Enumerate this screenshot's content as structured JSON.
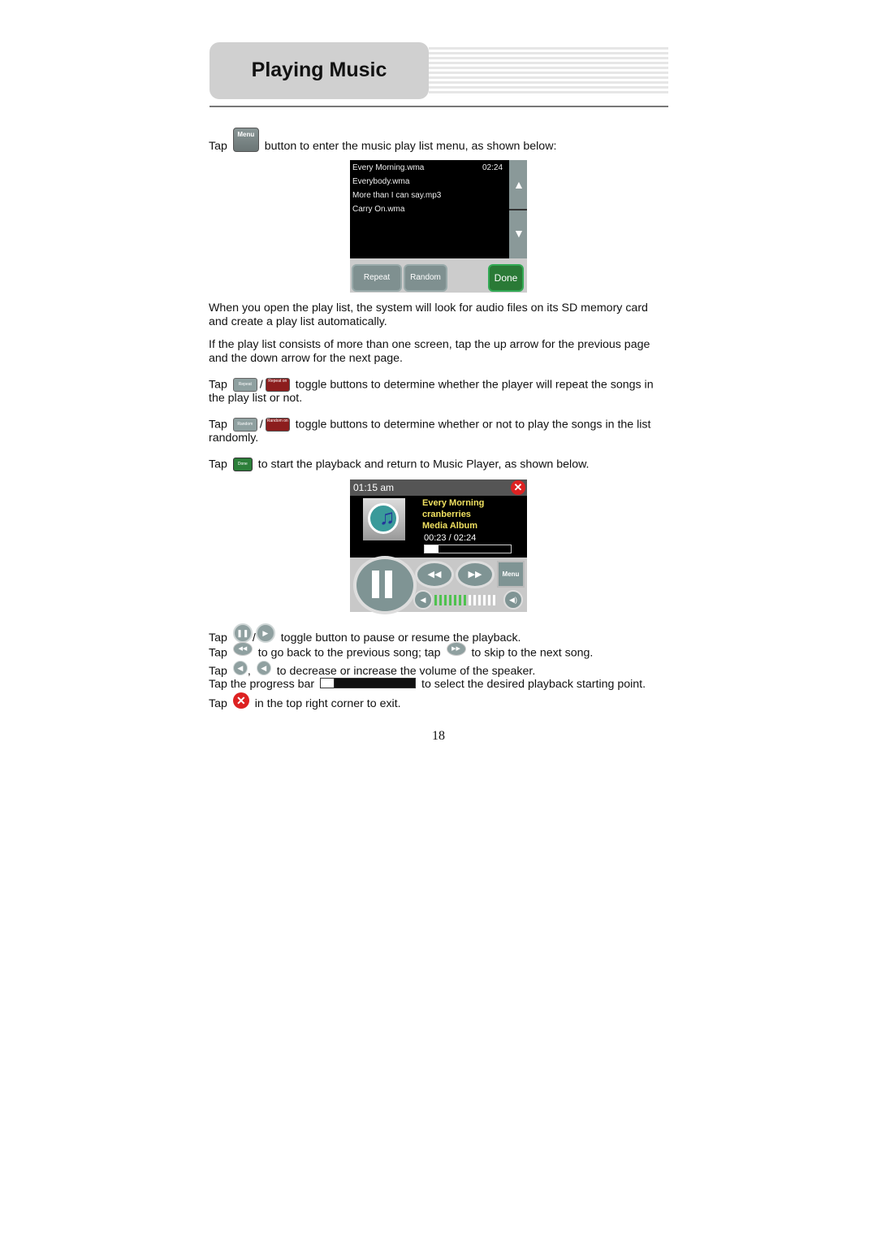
{
  "header": {
    "title": "Playing Music"
  },
  "intro": {
    "prefix": "Tap",
    "icon_label": "Menu",
    "suffix": "button to enter the music play list menu, as shown below:"
  },
  "playlist_screen": {
    "items": [
      "Every Morning.wma",
      "Everybody.wma",
      "More than I can say.mp3",
      "Carry On.wma"
    ],
    "current_duration": "02:24",
    "up_arrow": "▲",
    "down_arrow": "▼",
    "buttons": {
      "repeat": "Repeat",
      "random": "Random",
      "done": "Done"
    }
  },
  "paragraphs": {
    "p1": "When you open the play list, the system will look for audio files on its SD memory card and create a play list automatically.",
    "p2": "If the play list consists of more than one screen, tap the up arrow for the previous page and the down arrow for the next page."
  },
  "instructions": {
    "tap": "Tap",
    "slash": "/",
    "repeat_off_icon": "Repeat",
    "repeat_on_icon": "Repeat on",
    "repeat_text": "toggle buttons to determine whether the player will repeat the songs in",
    "repeat_text2": "the play list or not.",
    "random_off_icon": "Random",
    "random_on_icon": "Random on",
    "random_text": "toggle buttons to determine whether or not to play the songs in the list",
    "random_text2": "randomly.",
    "done_icon": "Done",
    "done_text": "to start the playback and return to Music Player, as shown below."
  },
  "player_screen": {
    "clock": "01:15  am",
    "title": "Every Morning",
    "artist": "cranberries",
    "album": "Media Album",
    "elapsed": "00:23",
    "separator": "/",
    "total": "02:24",
    "progress_fraction": 0.16,
    "volume_level": 7,
    "volume_max": 13,
    "menu_label": "Menu",
    "close_glyph": "✕",
    "rewind_glyph": "◀◀",
    "forward_glyph": "▶▶",
    "vol_down_glyph": "◀",
    "vol_up_glyph": "◀)",
    "accent_green": "#4fc24f",
    "title_color": "#f0e060"
  },
  "controls_help": {
    "pause_play_text": "toggle button to pause or resume the playback.",
    "prev_text": "to go back to the previous song; tap",
    "next_text": "to skip to the next song.",
    "comma": ",",
    "volume_text": "to decrease or increase the volume of the speaker.",
    "progress_prefix": "Tap the progress bar",
    "progress_text": "to select the desired playback starting point.",
    "exit_text": "in the top right corner to exit.",
    "pause_glyph": "❚❚",
    "play_glyph": "▶",
    "rew_glyph": "◀◀",
    "fwd_glyph": "▶▶",
    "vdown_glyph": "◀",
    "vup_glyph": "◀",
    "x_glyph": "✕"
  },
  "page_number": "18"
}
